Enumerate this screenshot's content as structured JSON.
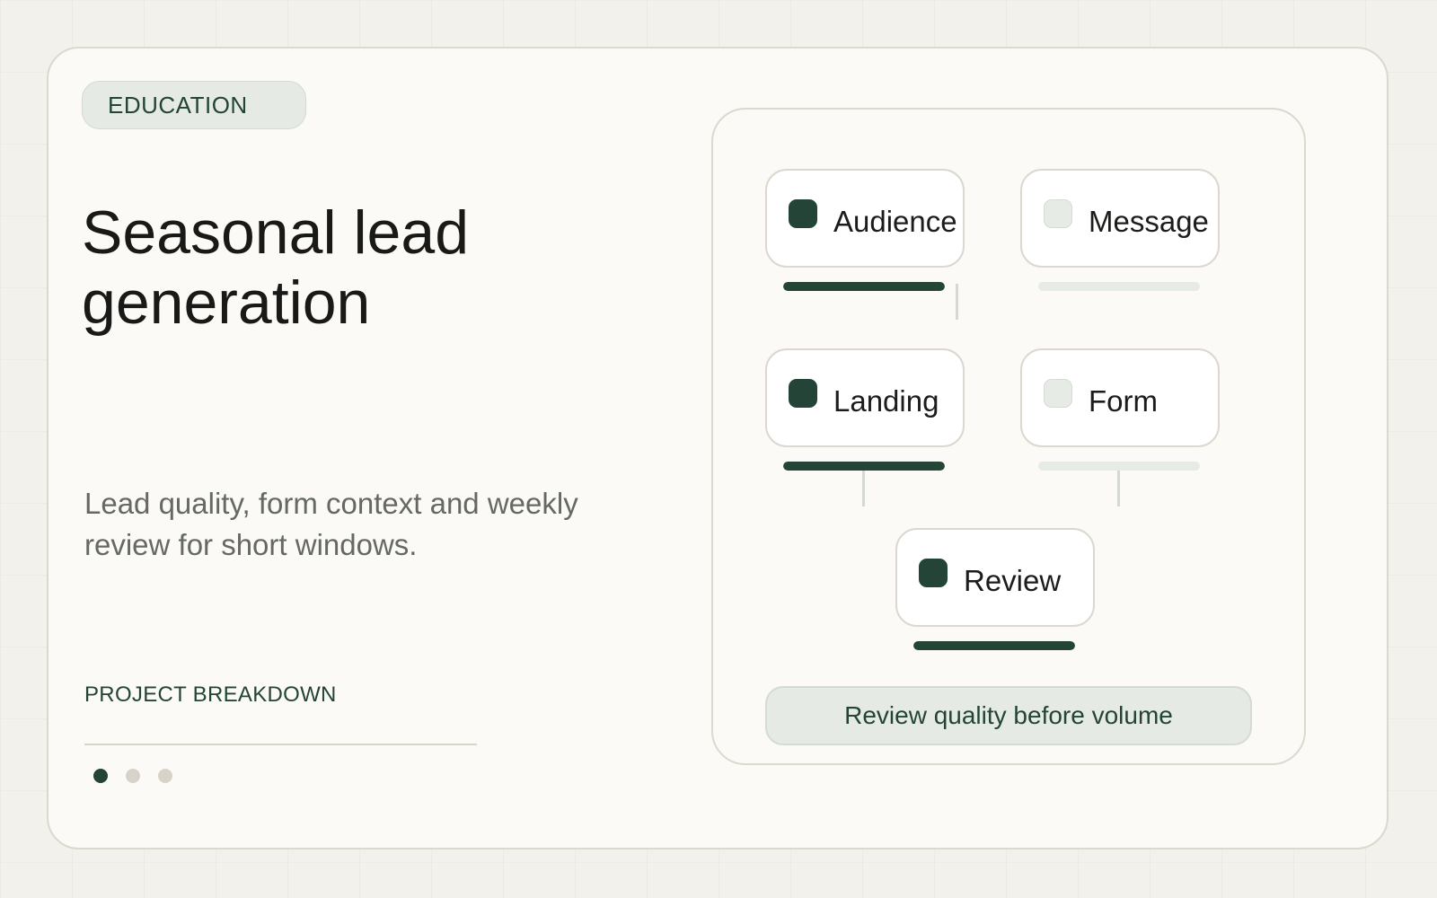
{
  "tag": "EDUCATION",
  "title": "Seasonal lead generation",
  "description": "Lead quality, form context and weekly review for short windows.",
  "breakdown_label": "PROJECT BREAKDOWN",
  "pagination": {
    "total": 3,
    "active": 1
  },
  "steps": [
    {
      "label": "Audience",
      "done": true,
      "progress": 1.0
    },
    {
      "label": "Message",
      "done": false,
      "progress": 0.0
    },
    {
      "label": "Landing",
      "done": true,
      "progress": 1.0
    },
    {
      "label": "Form",
      "done": false,
      "progress": 0.0
    },
    {
      "label": "Review",
      "done": true,
      "progress": 1.0
    }
  ],
  "summary": "Review quality before volume",
  "colors": {
    "accent": "#234437",
    "accent_soft": "#e5ebe4",
    "card_bg": "#fbfaf7",
    "page_bg": "#f3f1eb",
    "muted_text": "#666963"
  }
}
